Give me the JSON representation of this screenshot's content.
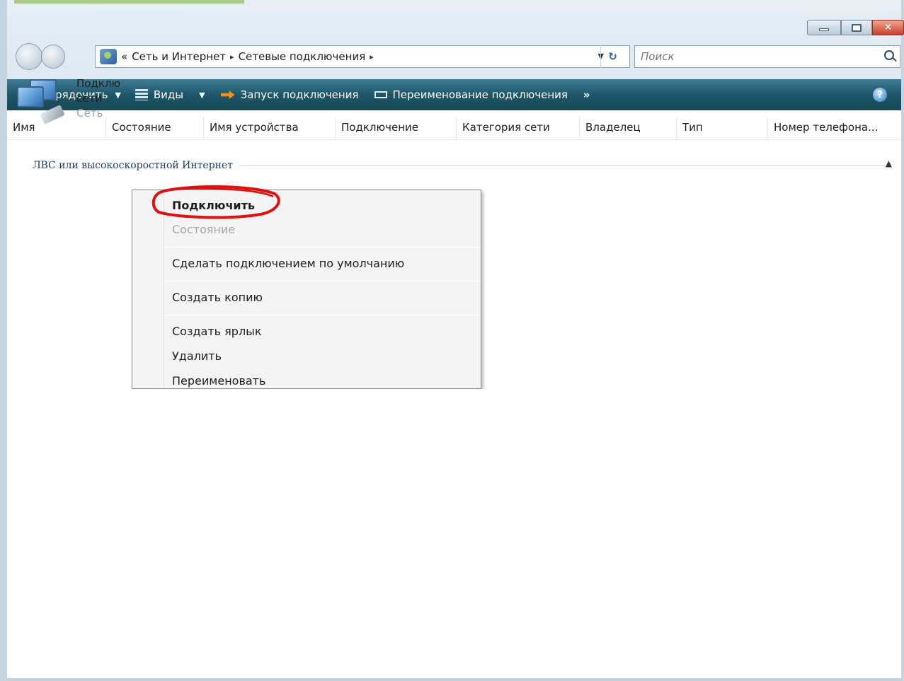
{
  "window": {
    "caption": {
      "minimize_icon": "minimize-icon",
      "maximize_icon": "maximize-icon",
      "close_glyph": "✕"
    }
  },
  "address_bar": {
    "overflow": "«",
    "crumbs": [
      "Сеть и Интернет",
      "Сетевые подключения"
    ],
    "separator": "▸"
  },
  "search": {
    "placeholder": "Поиск"
  },
  "command_bar": {
    "organize": "Упорядочить",
    "views": "Виды",
    "launch": "Запуск подключения",
    "rename": "Переименование подключения",
    "more": "»",
    "help": "?"
  },
  "columns": [
    "Имя",
    "Состояние",
    "Имя устройства",
    "Подключение",
    "Категория сети",
    "Владелец",
    "Тип",
    "Номер телефона..."
  ],
  "group": {
    "label": "ЛВС или высокоскоростной Интернет"
  },
  "connection": {
    "name_line1": "Подклю",
    "name_line2": "сети",
    "sub": "Сеть"
  },
  "context_menu": {
    "items": [
      "Подключить",
      "Состояние",
      "Сделать подключением по умолчанию",
      "Создать копию",
      "Создать ярлык",
      "Удалить",
      "Переименовать"
    ]
  },
  "colors": {
    "command_bar": "#1e5669",
    "highlight": "#e01010",
    "disabled_text": "#a6a6a6"
  }
}
